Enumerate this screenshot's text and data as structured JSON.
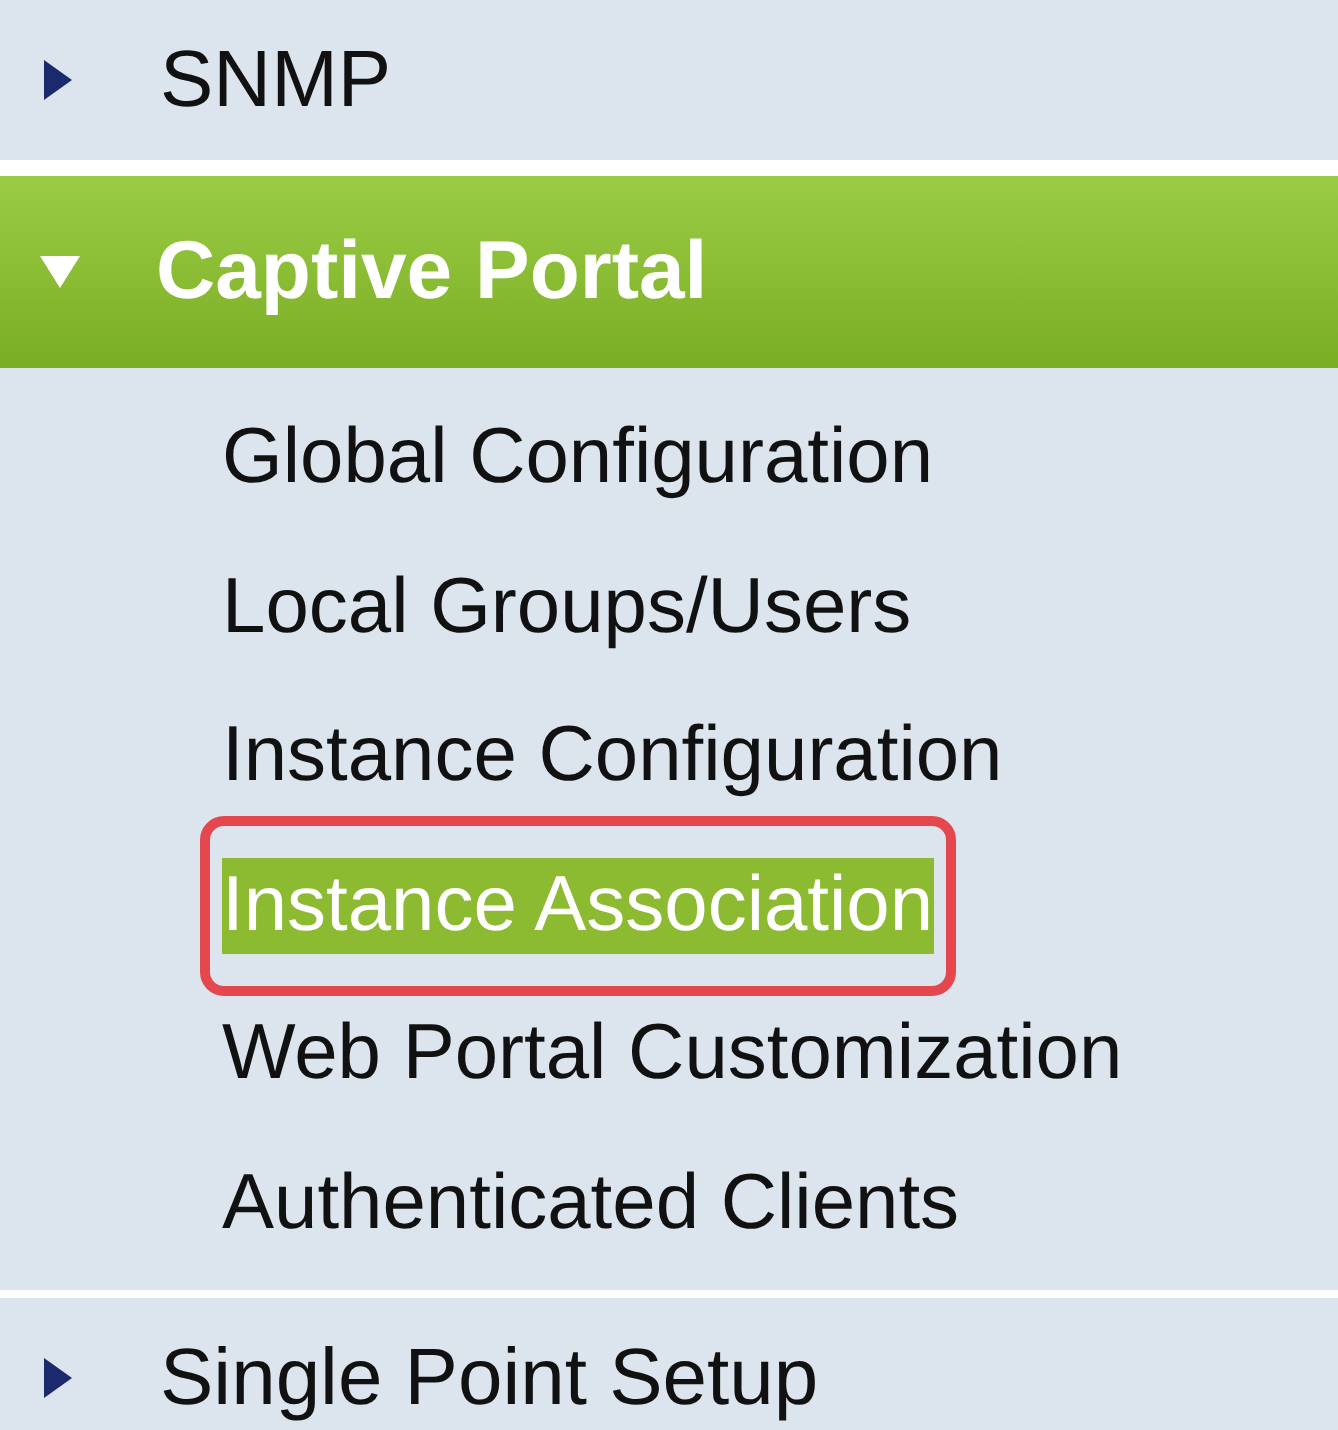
{
  "menu": [
    {
      "label": "SNMP",
      "expanded": false
    },
    {
      "label": "Captive Portal",
      "expanded": true,
      "children": [
        {
          "label": "Global Configuration",
          "selected": false
        },
        {
          "label": "Local Groups/Users",
          "selected": false
        },
        {
          "label": "Instance Configuration",
          "selected": false
        },
        {
          "label": "Instance Association",
          "selected": true
        },
        {
          "label": "Web Portal Customization",
          "selected": false
        },
        {
          "label": "Authenticated Clients",
          "selected": false
        }
      ]
    },
    {
      "label": "Single Point Setup",
      "expanded": false
    }
  ]
}
